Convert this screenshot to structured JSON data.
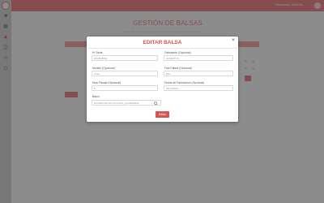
{
  "header": {
    "user_name": "Bienvenido: Yo/ALFA..."
  },
  "sidebar": {
    "items": [
      {
        "icon": "home-icon"
      },
      {
        "icon": "gallery-icon"
      },
      {
        "icon": "user-icon"
      },
      {
        "icon": "bar-chart-icon"
      },
      {
        "icon": "line-chart-icon"
      },
      {
        "icon": "power-icon"
      }
    ]
  },
  "page": {
    "title": "GESTIÓN DE BALSAS",
    "subtitle": "Desde esta sección podrá gestionar las balsas registradas en el sistema"
  },
  "modal": {
    "title": "EDITAR BALSA",
    "fields": {
      "serial": {
        "label": "Nº Serie",
        "value": "R6A5D2B91"
      },
      "maker": {
        "label": "Fabricante (Opcional)",
        "value": "ALSEPTUN"
      },
      "model": {
        "label": "Modelo (Opcional)",
        "value": "Oceo"
      },
      "fast_status": {
        "label": "Fast Fabrid (Opcional)",
        "value": "B16"
      },
      "num_people": {
        "label": "Num Pasaje (Opcional)",
        "value": "6"
      },
      "manufacture_date": {
        "label": "Fecha de Fabricación (Opcional)",
        "value": "04/10/2019"
      },
      "vessel": {
        "label": "Barco",
        "value": "HICSDE-NPLACTOLA-EIG_ALGERMIPE"
      }
    },
    "save_label": "Editar"
  }
}
